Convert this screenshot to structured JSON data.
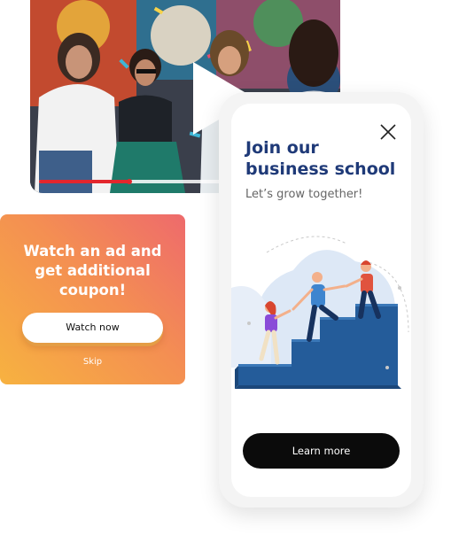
{
  "video": {
    "progress": 0.32,
    "colors": {
      "progress": "#e3262d"
    }
  },
  "coupon": {
    "title": "Watch an ad and\nget  additional\ncoupon!",
    "watch_label": "Watch now",
    "skip_label": "Skip"
  },
  "promo": {
    "title": "Join our\nbusiness school",
    "subtitle": "Let’s grow together!",
    "cta_label": "Learn more",
    "colors": {
      "title": "#1f3a78",
      "stairs": "#245c9a"
    }
  }
}
